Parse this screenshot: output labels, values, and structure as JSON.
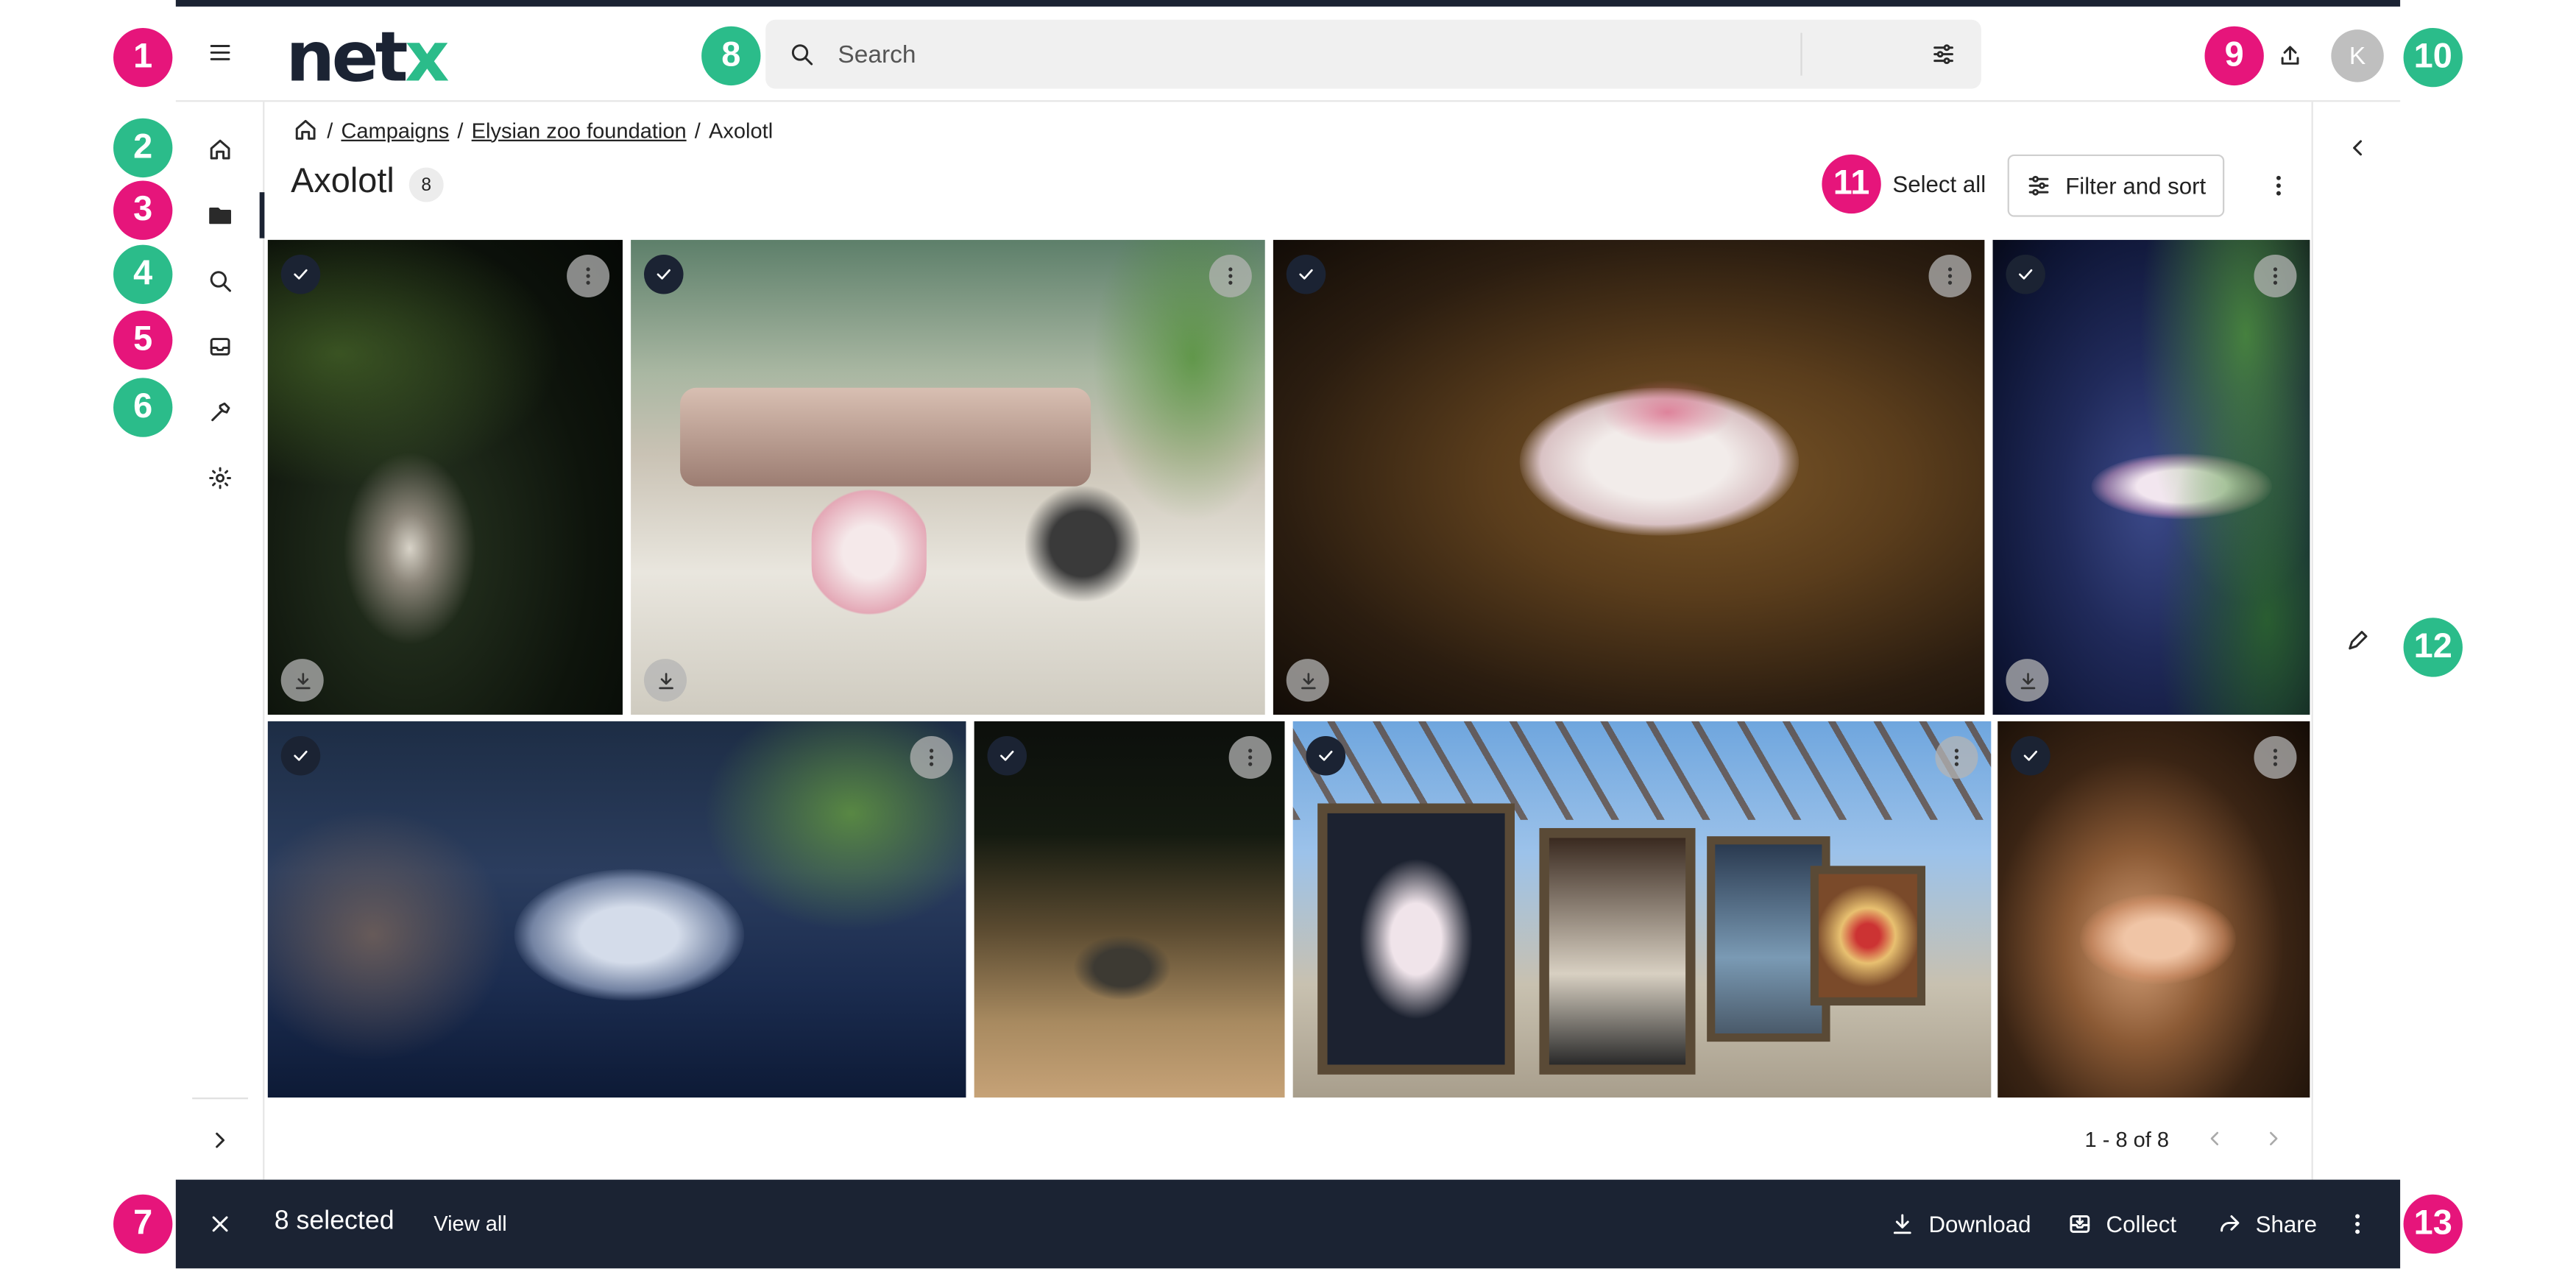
{
  "brand": {
    "logo_text": "netx",
    "logo_colors": {
      "dark": "#1b2333",
      "accent": "#2bbc8a"
    }
  },
  "search": {
    "placeholder": "Search"
  },
  "user": {
    "avatar_initial": "K"
  },
  "breadcrumb": {
    "items": [
      "Campaigns",
      "Elysian zoo foundation"
    ],
    "current": "Axolotl",
    "separator": "/"
  },
  "page": {
    "title": "Axolotl",
    "count": "8"
  },
  "toolbar": {
    "select_all_label": "Select all",
    "filter_label": "Filter and sort"
  },
  "pagination": {
    "range_text": "1 - 8 of 8"
  },
  "selection_bar": {
    "selected_text": "8 selected",
    "view_all_label": "View all",
    "download_label": "Download",
    "collect_label": "Collect",
    "share_label": "Share"
  },
  "callouts": {
    "c1": "1",
    "c2": "2",
    "c3": "3",
    "c4": "4",
    "c5": "5",
    "c6": "6",
    "c7": "7",
    "c8": "8",
    "c9": "9",
    "c10": "10",
    "c11": "11",
    "c12": "12",
    "c13": "13"
  },
  "colors": {
    "callout_pink": "#e6157b",
    "callout_green": "#2bbc8a",
    "bar_dark": "#1b2333"
  },
  "icons": {
    "topbar": [
      "menu-icon",
      "search-icon",
      "sliders-icon",
      "upload-icon"
    ],
    "leftnav": [
      "home-icon",
      "folder-icon",
      "search-icon",
      "inbox-icon",
      "hammer-icon",
      "gear-icon",
      "chevron-right-icon"
    ],
    "rightpanel": [
      "chevron-left-icon",
      "pencil-icon"
    ]
  }
}
